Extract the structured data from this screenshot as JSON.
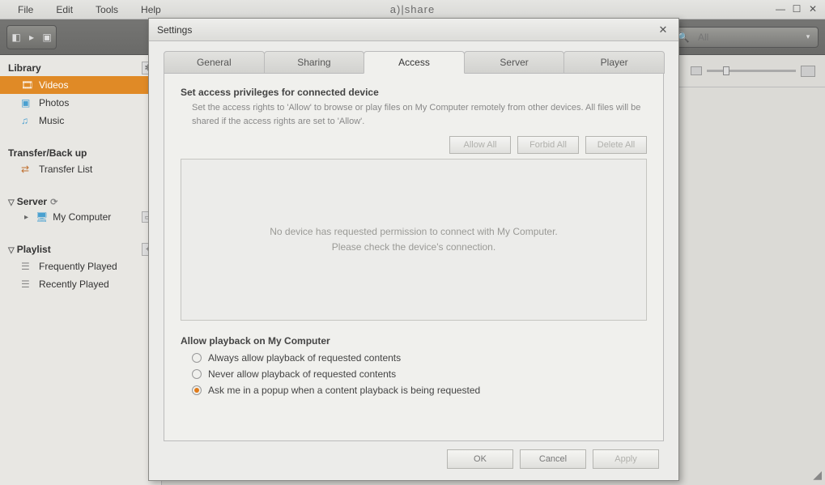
{
  "menubar": {
    "items": [
      "File",
      "Edit",
      "Tools",
      "Help"
    ],
    "apptitle": "a)|share"
  },
  "search": {
    "placeholder": "All"
  },
  "sidebar": {
    "library": {
      "title": "Library",
      "items": [
        {
          "label": "Videos",
          "active": true
        },
        {
          "label": "Photos"
        },
        {
          "label": "Music"
        }
      ]
    },
    "transfer": {
      "title": "Transfer/Back up",
      "item": "Transfer List"
    },
    "server": {
      "title": "Server",
      "item": "My Computer"
    },
    "playlist": {
      "title": "Playlist",
      "items": [
        "Frequently Played",
        "Recently Played"
      ]
    }
  },
  "dialog": {
    "title": "Settings",
    "tabs": [
      "General",
      "Sharing",
      "Access",
      "Server",
      "Player"
    ],
    "activeTab": "Access",
    "access": {
      "section_title": "Set access privileges for connected device",
      "section_desc": "Set the access rights to 'Allow' to browse or play files on My Computer remotely from other devices. All files will be shared if the access rights are set to 'Allow'.",
      "allow_all": "Allow All",
      "forbid_all": "Forbid All",
      "delete_all": "Delete All",
      "empty_msg_1": "No device has requested permission to connect with My Computer.",
      "empty_msg_2": "Please check the device's connection.",
      "playback_title": "Allow playback on My Computer",
      "radios": [
        "Always allow playback of requested contents",
        "Never allow playback of requested contents",
        "Ask me in a popup when a content playback is being requested"
      ],
      "selected_radio": 2
    },
    "footer": {
      "ok": "OK",
      "cancel": "Cancel",
      "apply": "Apply"
    }
  }
}
